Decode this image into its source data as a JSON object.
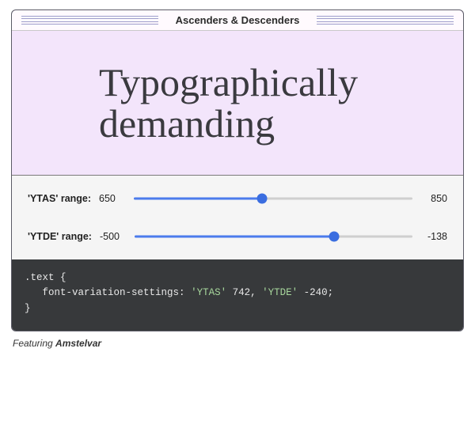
{
  "header": {
    "title": "Ascenders & Descenders"
  },
  "sample": {
    "text": "Typographically\ndemanding"
  },
  "sliders": {
    "ytas": {
      "label": "'YTAS' range:",
      "min": 650,
      "max": 850,
      "value": 742
    },
    "ytde": {
      "label": "'YTDE' range:",
      "min": -500,
      "max": -138,
      "value": -240
    }
  },
  "code": {
    "selector": ".text {",
    "prop": "font-variation-settings:",
    "k1": "'YTAS'",
    "v1": "742",
    "k2": "'YTDE'",
    "v2": "-240",
    "close": "}"
  },
  "caption": {
    "prefix": "Featuring ",
    "font_name": "Amstelvar"
  }
}
